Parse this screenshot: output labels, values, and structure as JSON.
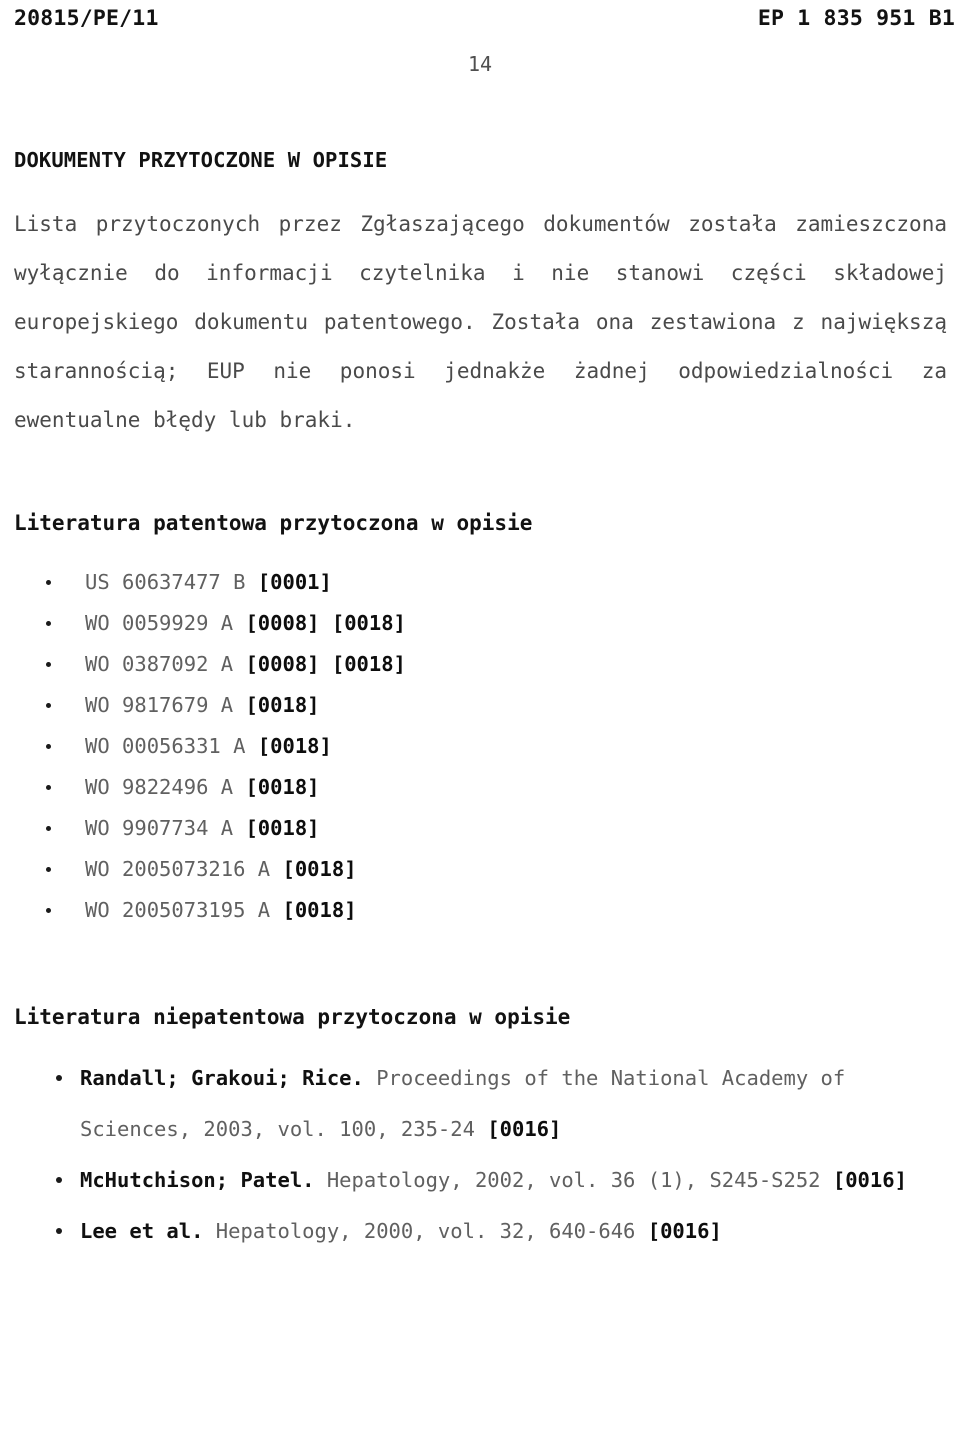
{
  "header": {
    "left": "20815/PE/11",
    "right": "EP 1 835 951 B1",
    "page_number": "14"
  },
  "section": {
    "title": "DOKUMENTY PRZYTOCZONE W OPISIE",
    "disclaimer": "Lista przytoczonych przez Zgłaszającego dokumentów została zamieszczona wyłącznie do informacji czytelnika i nie stanowi części składowej europejskiego dokumentu patentowego. Została ona zestawiona z największą starannością; EUP nie ponosi jednakże żadnej odpowiedzialności za ewentualne błędy lub braki."
  },
  "patent_literature": {
    "heading": "Literatura patentowa przytoczona w opisie",
    "items": [
      {
        "doc": "US 60637477 B",
        "refs": "[0001]"
      },
      {
        "doc": "WO 0059929 A",
        "refs": "[0008] [0018]"
      },
      {
        "doc": "WO 0387092 A",
        "refs": "[0008] [0018]"
      },
      {
        "doc": "WO 9817679 A",
        "refs": "[0018]"
      },
      {
        "doc": "WO 00056331 A",
        "refs": "[0018]"
      },
      {
        "doc": "WO 9822496 A",
        "refs": "[0018]"
      },
      {
        "doc": "WO 9907734 A",
        "refs": "[0018]"
      },
      {
        "doc": "WO 2005073216 A",
        "refs": "[0018]"
      },
      {
        "doc": "WO 2005073195 A",
        "refs": "[0018]"
      }
    ]
  },
  "nonpatent_literature": {
    "heading": "Literatura niepatentowa przytoczona w opisie",
    "items": [
      {
        "authors": "Randall; Grakoui; Rice.",
        "citation": "Proceedings of the National Academy of Sciences, 2003, vol. 100, 235-24",
        "refs": "[0016]"
      },
      {
        "authors": "McHutchison; Patel.",
        "citation": "Hepatology, 2002, vol. 36 (1), S245-S252",
        "refs": "[0016]"
      },
      {
        "authors": "Lee et al.",
        "citation": "Hepatology, 2000, vol. 32, 640-646",
        "refs": "[0016]"
      }
    ]
  }
}
